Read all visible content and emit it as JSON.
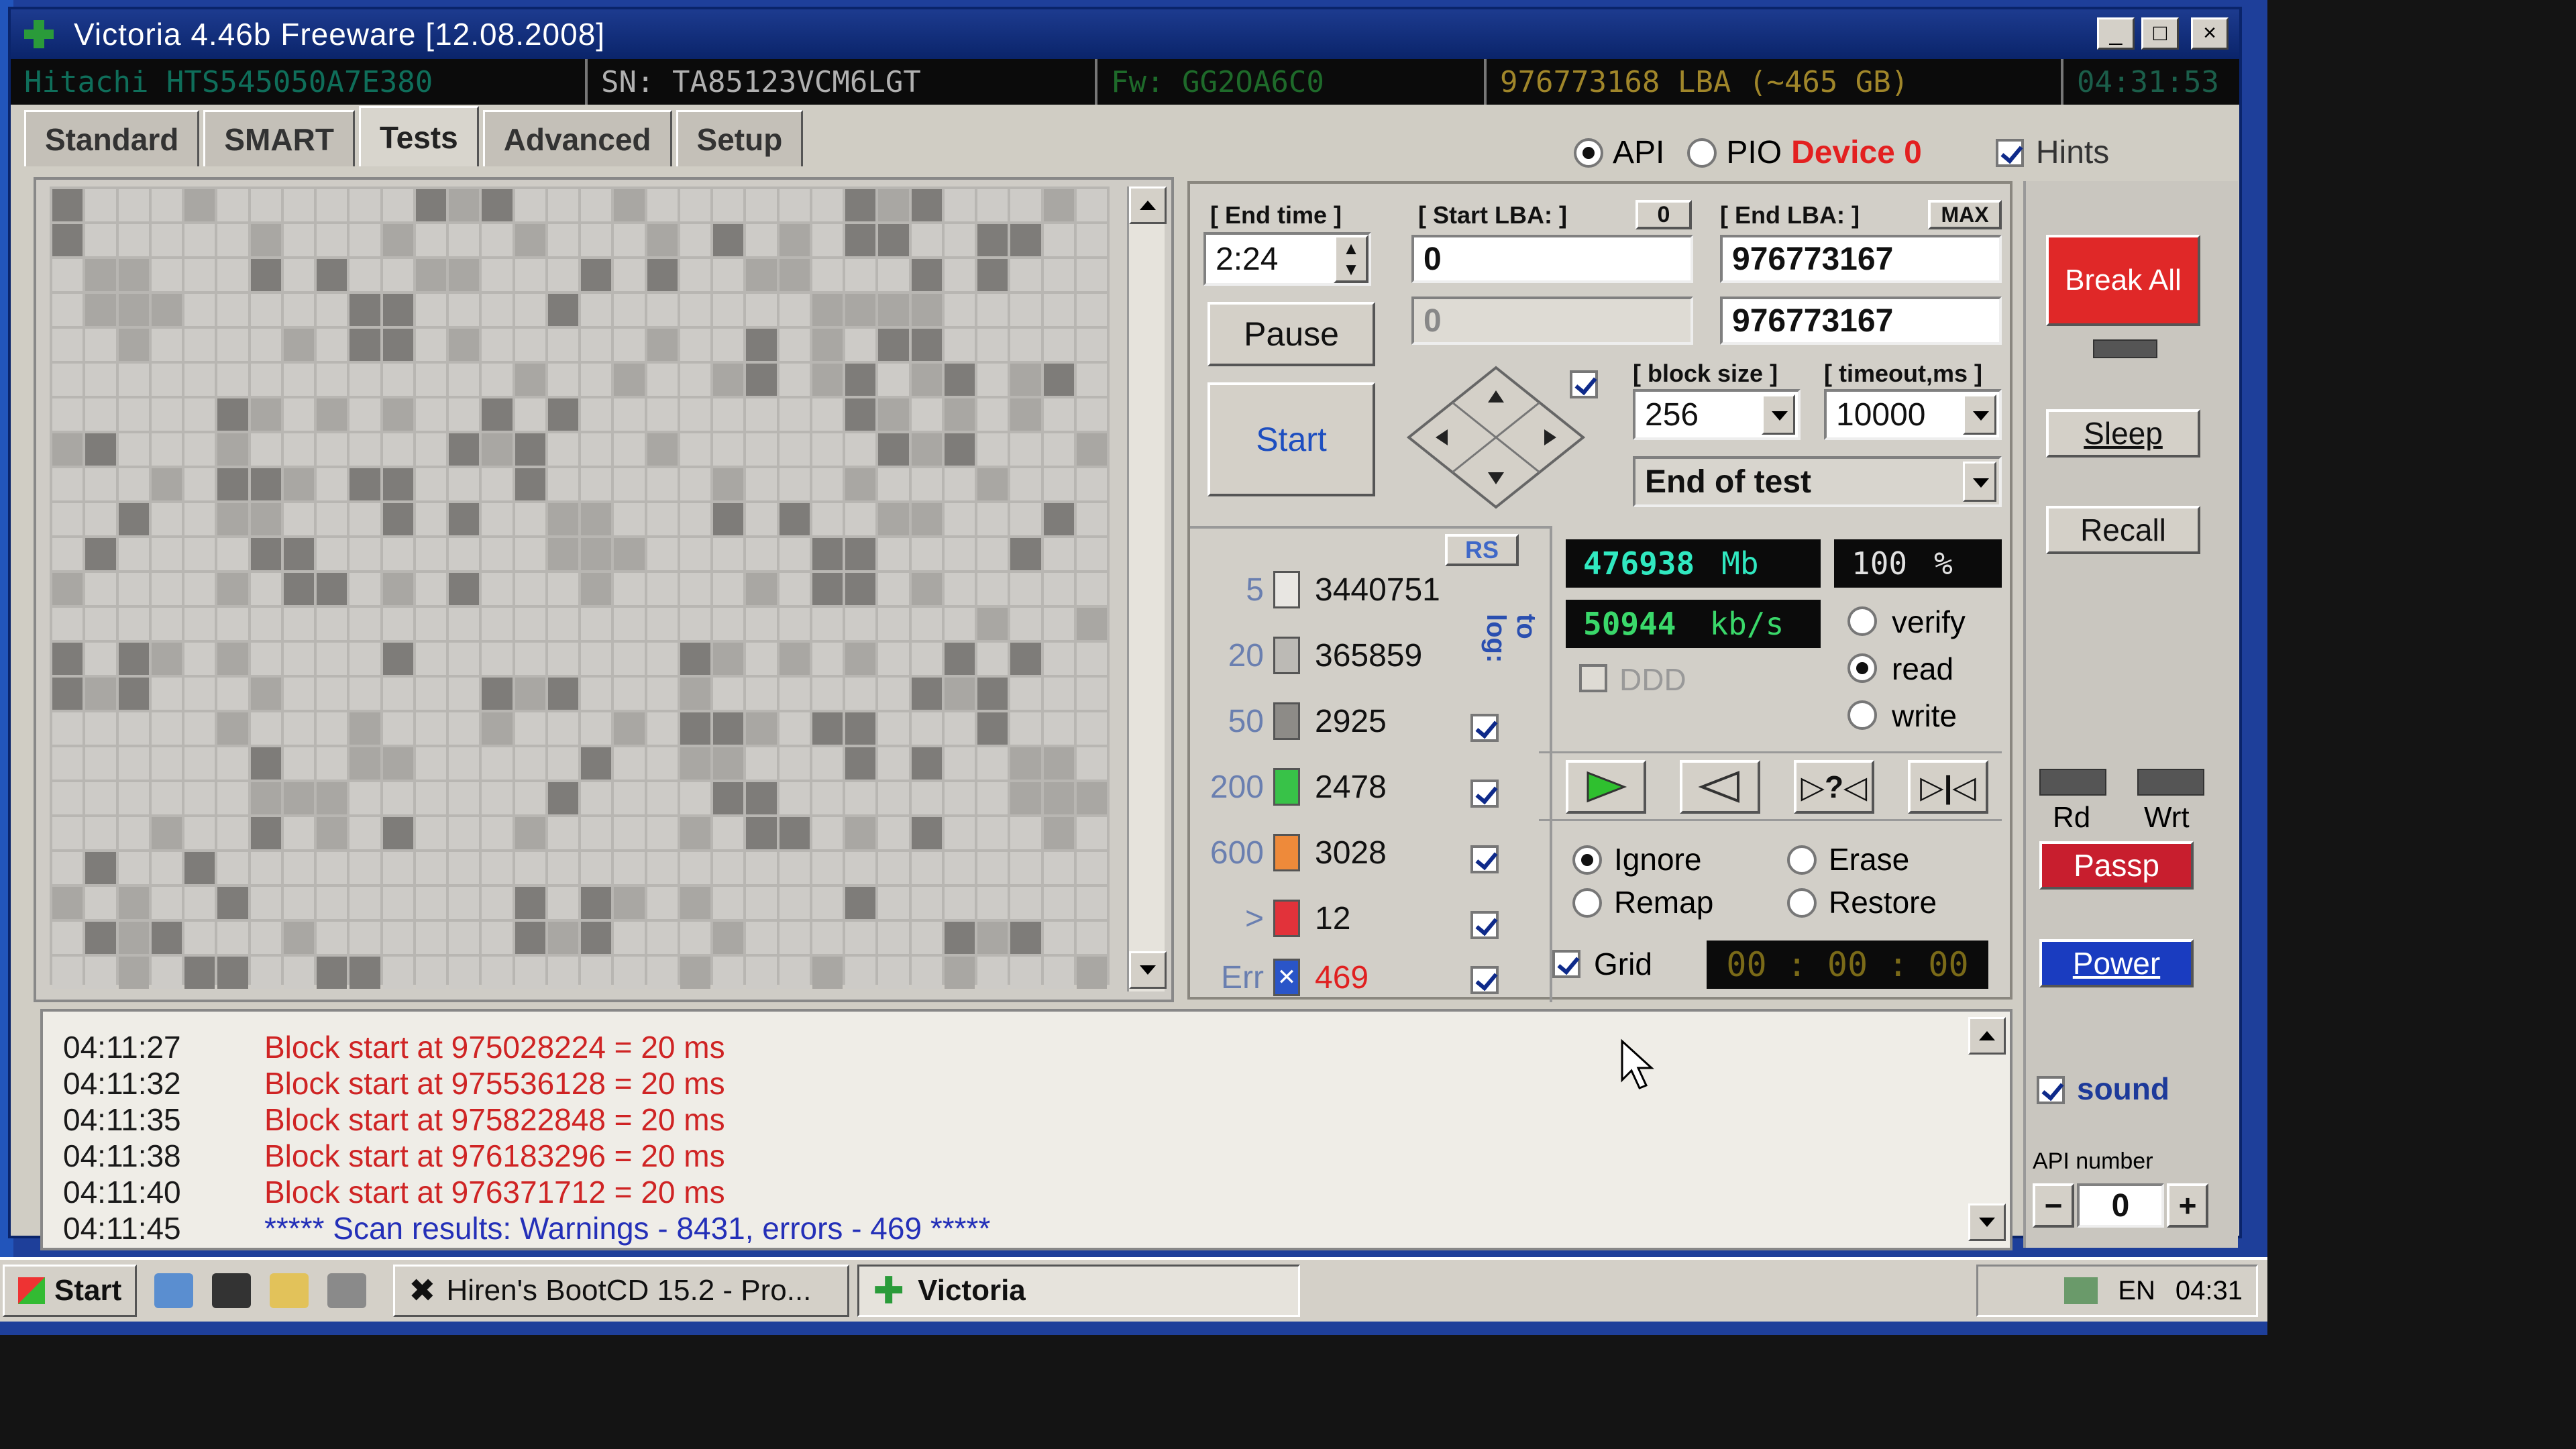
{
  "window": {
    "title": "Victoria 4.46b Freeware [12.08.2008]",
    "min_label": "_",
    "max_label": "□",
    "close_label": "×"
  },
  "info": {
    "model": "Hitachi HTS545050A7E380",
    "serial": "SN: TA85123VCM6LGT",
    "firmware": "Fw: GG2OA6C0",
    "lba": "976773168 LBA (~465 GB)",
    "clock": "04:31:53"
  },
  "tabs": [
    {
      "label": "Standard"
    },
    {
      "label": "SMART"
    },
    {
      "label": "Tests"
    },
    {
      "label": "Advanced"
    },
    {
      "label": "Setup"
    }
  ],
  "active_tab": "Tests",
  "mode": {
    "api_label": "API",
    "pio_label": "PIO",
    "device_label": "Device 0",
    "selected": "API",
    "hints_label": "Hints",
    "hints_checked": true
  },
  "test": {
    "end_time_label": "[ End time ]",
    "end_time_value": "2:24",
    "start_lba_label": "[ Start LBA: ]",
    "start_lba_zero": "0",
    "start_lba_value": "0",
    "start_lba_current": "0",
    "end_lba_label": "[ End LBA: ]",
    "end_lba_max": "MAX",
    "end_lba_value": "976773167",
    "end_lba_current": "976773167",
    "pause_label": "Pause",
    "start_label": "Start",
    "block_size_label": "[ block size ]",
    "block_size_value": "256",
    "timeout_label": "[ timeout,ms ]",
    "timeout_value": "10000",
    "end_action_value": "End of test"
  },
  "stats": {
    "rs_label": "RS",
    "to_log_label": "to log:",
    "rows": [
      {
        "label": "5",
        "value": "3440751",
        "color": "#e8e6e2",
        "logged": false
      },
      {
        "label": "20",
        "value": "365859",
        "color": "#bcbab5",
        "logged": false
      },
      {
        "label": "50",
        "value": "2925",
        "color": "#8d8b87",
        "logged": true
      },
      {
        "label": "200",
        "value": "2478",
        "color": "#38c248",
        "logged": true
      },
      {
        "label": "600",
        "value": "3028",
        "color": "#ee8a3a",
        "logged": true
      },
      {
        "label": ">",
        "value": "12",
        "color": "#e2323a",
        "logged": true
      },
      {
        "label": "Err",
        "value": "469",
        "color": "#2a55c8",
        "logged": true
      }
    ]
  },
  "readout": {
    "mb_value": "476938",
    "mb_unit": "Mb",
    "percent_value": "100",
    "percent_unit": "%",
    "speed_value": "50944",
    "speed_unit": "kb/s",
    "ddd_label": "DDD",
    "verify_label": "verify",
    "read_label": "read",
    "write_label": "write",
    "selected_op": "read"
  },
  "transport": {
    "play_icon": "play-icon",
    "rewind_icon": "rewind-icon",
    "skip_icon": "skip-random-icon",
    "end_icon": "skip-end-icon"
  },
  "actions": {
    "ignore_label": "Ignore",
    "erase_label": "Erase",
    "remap_label": "Remap",
    "restore_label": "Restore",
    "selected": "Ignore",
    "grid_label": "Grid",
    "grid_checked": true,
    "timer_value": "00 : 00 : 00"
  },
  "side": {
    "break_label": "Break All",
    "sleep_label": "Sleep",
    "recall_label": "Recall",
    "rd_label": "Rd",
    "wrt_label": "Wrt",
    "passp_label": "Passp",
    "power_label": "Power",
    "sound_label": "sound",
    "sound_checked": true,
    "api_number_label": "API number",
    "api_number_value": "0",
    "minus_label": "−",
    "plus_label": "+"
  },
  "log": [
    {
      "time": "04:11:27",
      "msg": "Block start at 975028224 = 20 ms",
      "kind": "warn"
    },
    {
      "time": "04:11:32",
      "msg": "Block start at 975536128 = 20 ms",
      "kind": "warn"
    },
    {
      "time": "04:11:35",
      "msg": "Block start at 975822848 = 20 ms",
      "kind": "warn"
    },
    {
      "time": "04:11:38",
      "msg": "Block start at 976183296 = 20 ms",
      "kind": "warn"
    },
    {
      "time": "04:11:40",
      "msg": "Block start at 976371712 = 20 ms",
      "kind": "warn"
    },
    {
      "time": "04:11:45",
      "msg": "***** Scan results: Warnings - 8431, errors - 469 *****",
      "kind": "info"
    }
  ],
  "taskbar": {
    "start_label": "Start",
    "task1_label": "Hiren's BootCD 15.2 - Pro...",
    "task2_label": "Victoria",
    "lang": "EN",
    "time": "04:31"
  }
}
